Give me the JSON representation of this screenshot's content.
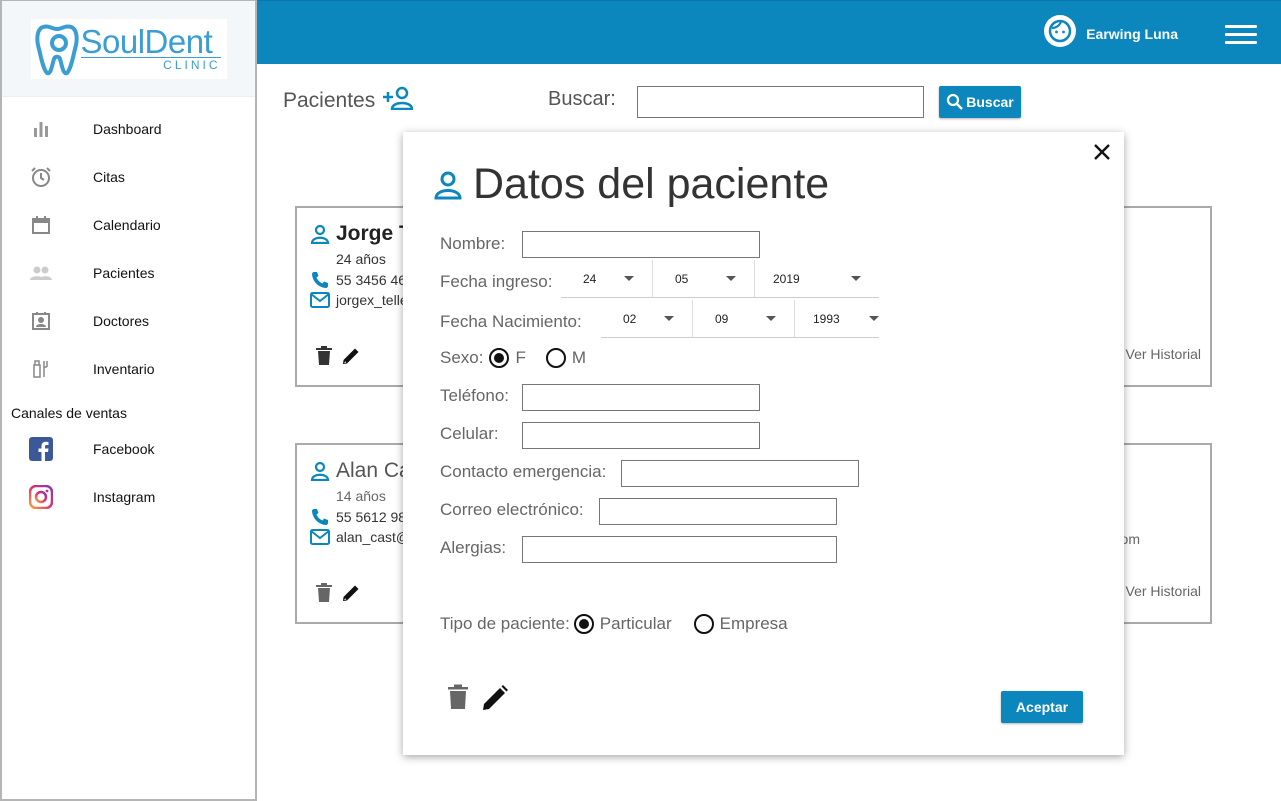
{
  "brand": {
    "name": "SoulDent",
    "sub": "CLINIC"
  },
  "sidebar": {
    "items": [
      {
        "label": "Dashboard",
        "icon": "bar-chart-icon"
      },
      {
        "label": "Citas",
        "icon": "alarm-clock-icon"
      },
      {
        "label": "Calendario",
        "icon": "calendar-icon"
      },
      {
        "label": "Pacientes",
        "icon": "people-icon"
      },
      {
        "label": "Doctores",
        "icon": "badge-icon"
      },
      {
        "label": "Inventario",
        "icon": "tools-icon"
      }
    ],
    "section_title": "Canales de ventas",
    "social": [
      {
        "label": "Facebook",
        "icon": "facebook-icon"
      },
      {
        "label": "Instagram",
        "icon": "instagram-icon"
      }
    ]
  },
  "header": {
    "user_name": "Earwing Luna"
  },
  "toolbar": {
    "title": "Pacientes",
    "search_label": "Buscar:",
    "search_value": "",
    "search_button": "Buscar"
  },
  "patients": [
    {
      "name": "Jorge T",
      "age": "24 años",
      "phone": "55 3456 46",
      "email": "jorgex_telle",
      "history": "Ver Historial",
      "extra": ""
    },
    {
      "name": "Alan Ca",
      "age": "14 años",
      "phone": "55 5612 98",
      "email": "alan_cast@",
      "history": "Ver Historial",
      "extra": "om"
    }
  ],
  "modal": {
    "title": "Datos del paciente",
    "labels": {
      "nombre": "Nombre:",
      "fecha_ingreso": "Fecha ingreso:",
      "fecha_nacimiento": "Fecha Nacimiento:",
      "sexo": "Sexo:",
      "telefono": "Teléfono:",
      "celular": "Celular:",
      "contacto": "Contacto emergencia:",
      "correo": "Correo electrónico:",
      "alergias": "Alergias:",
      "tipo": "Tipo de paciente:"
    },
    "fecha_ingreso": {
      "day": "24",
      "month": "05",
      "year": "2019"
    },
    "fecha_nacimiento": {
      "day": "02",
      "month": "09",
      "year": "1993"
    },
    "sexo": {
      "options": [
        "F",
        "M"
      ],
      "selected": "F"
    },
    "tipo": {
      "options": [
        "Particular",
        "Empresa"
      ],
      "selected": "Particular"
    },
    "accept_label": "Aceptar"
  },
  "colors": {
    "primary": "#0b87be",
    "text": "#333333"
  }
}
